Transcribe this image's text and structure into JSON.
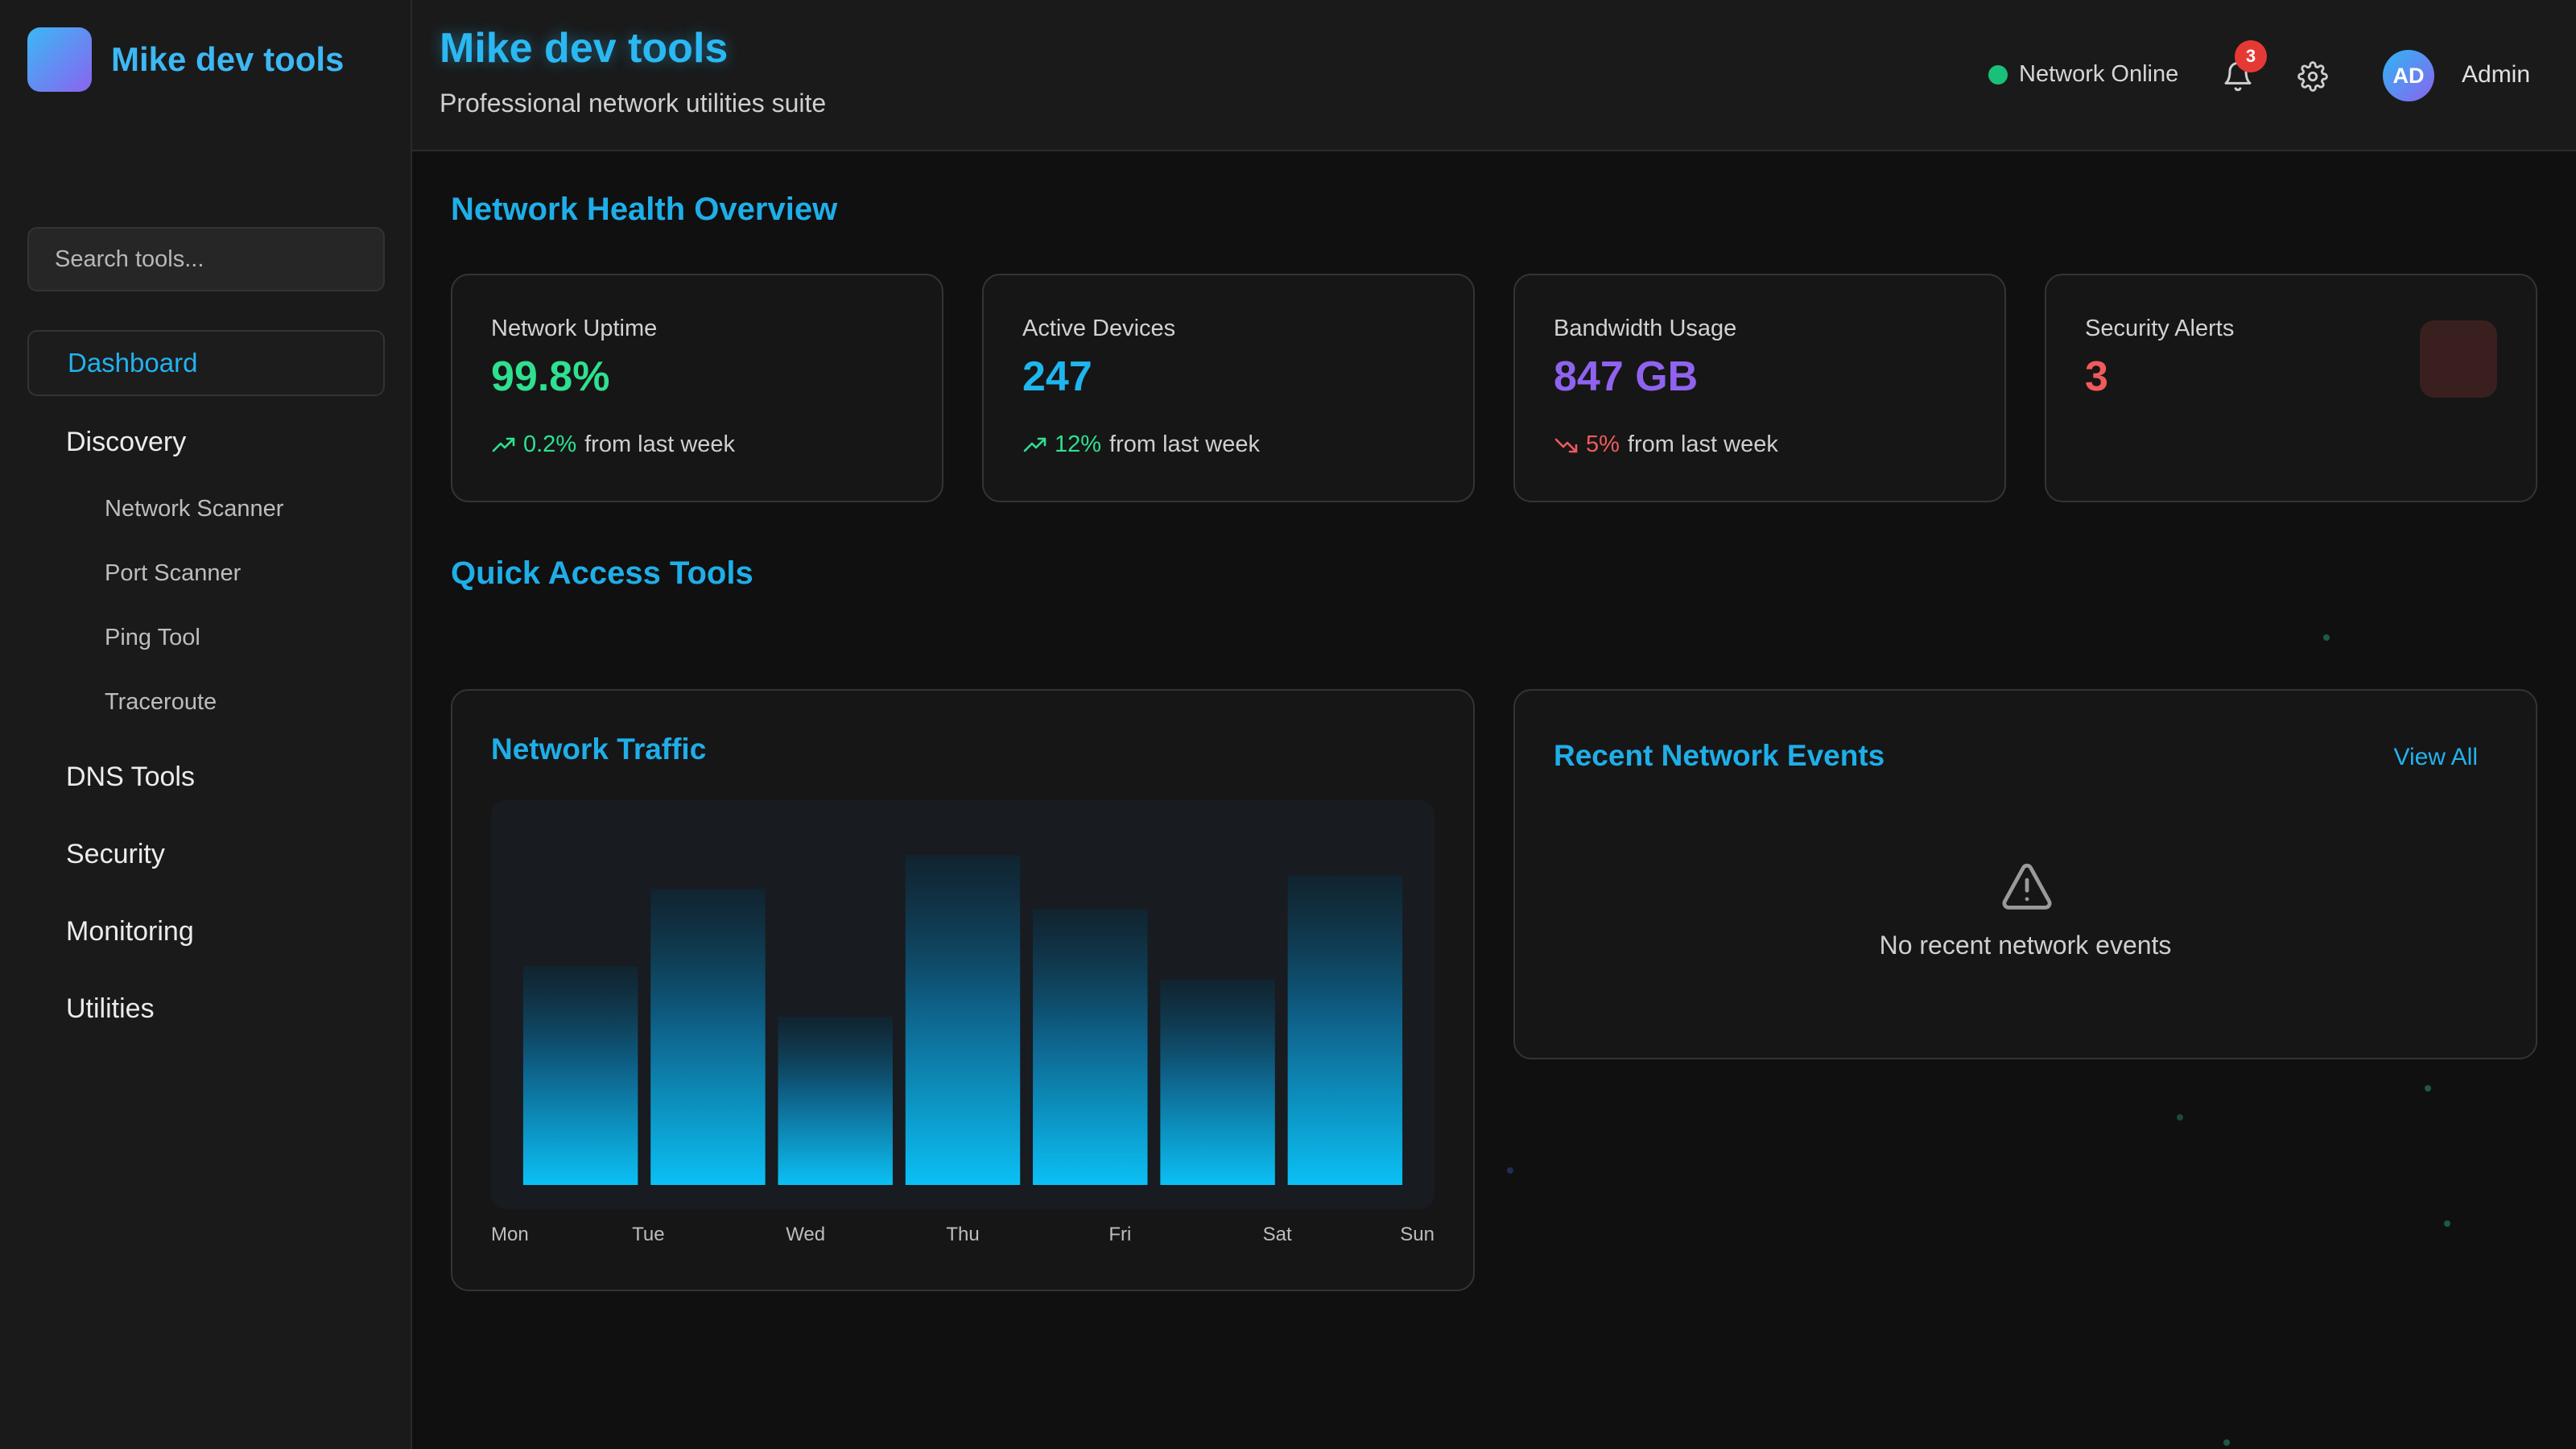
{
  "brand": {
    "name": "Mike dev tools"
  },
  "header": {
    "title": "Mike dev tools",
    "subtitle": "Professional network utilities suite",
    "status": "Network Online",
    "notifications": "3",
    "avatar_initials": "AD",
    "user": "Admin"
  },
  "sidebar": {
    "search_placeholder": "Search tools...",
    "active": "Dashboard",
    "discovery": "Discovery",
    "sub": [
      "Network Scanner",
      "Port Scanner",
      "Ping Tool",
      "Traceroute"
    ],
    "items": [
      "DNS Tools",
      "Security",
      "Monitoring",
      "Utilities"
    ]
  },
  "overview": {
    "title": "Network Health Overview",
    "cards": [
      {
        "label": "Network Uptime",
        "value": "99.8%",
        "trend": "0.2%",
        "trend_rest": "from last week",
        "color": "#2ee08f",
        "trend_color": "#2ee08f"
      },
      {
        "label": "Active Devices",
        "value": "247",
        "trend": "12%",
        "trend_rest": "from last week",
        "color": "#1eb6ef",
        "trend_color": "#2ee08f"
      },
      {
        "label": "Bandwidth Usage",
        "value": "847 GB",
        "trend": "5%",
        "trend_rest": "from last week",
        "color": "#8f63ef",
        "trend_color": "#ef5b5b"
      },
      {
        "label": "Security Alerts",
        "value": "3",
        "color": "#ef5b5b"
      }
    ]
  },
  "quick_access": {
    "title": "Quick Access Tools"
  },
  "traffic": {
    "title": "Network Traffic"
  },
  "events": {
    "title": "Recent Network Events",
    "view_all": "View All",
    "empty": "No recent network events"
  },
  "chart_data": {
    "type": "bar",
    "categories": [
      "Mon",
      "Tue",
      "Wed",
      "Thu",
      "Fri",
      "Sat",
      "Sun"
    ],
    "values": [
      65,
      88,
      50,
      98,
      82,
      61,
      92
    ],
    "ylim": [
      0,
      100
    ]
  }
}
